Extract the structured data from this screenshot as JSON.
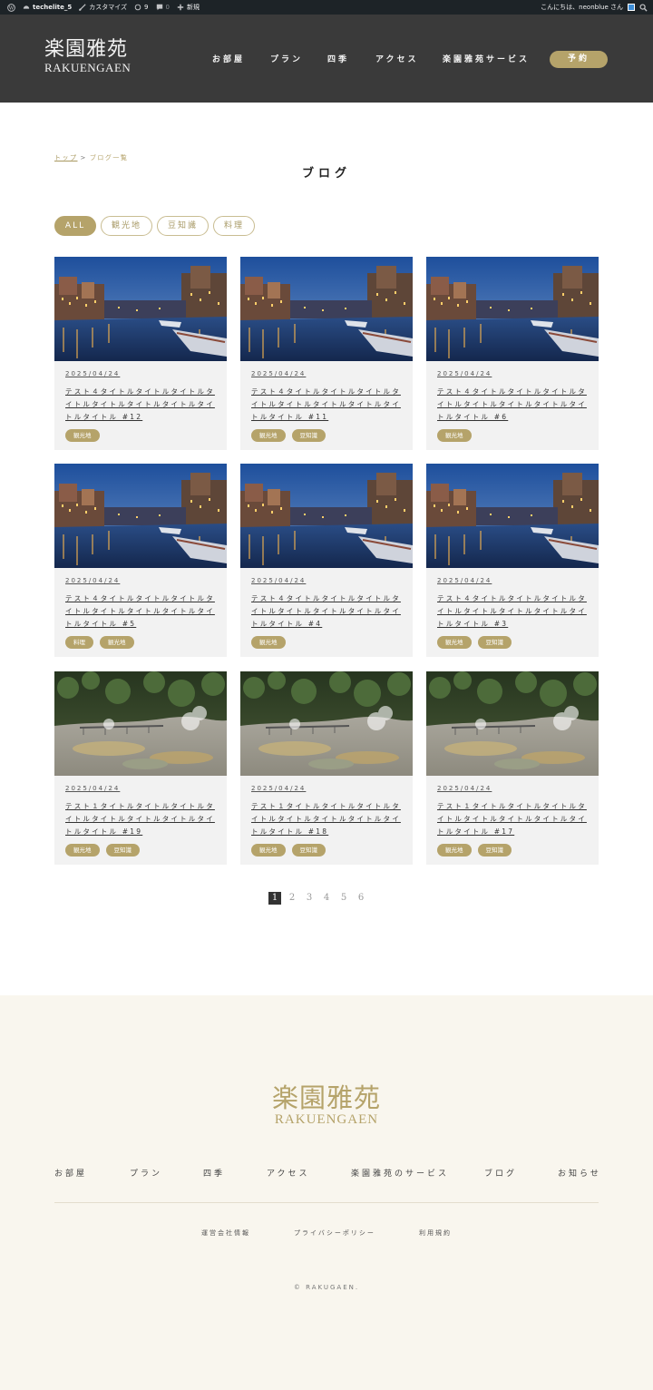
{
  "admin_bar": {
    "site_name": "techelite_5",
    "customize": "カスタマイズ",
    "updates_count": "9",
    "comments_count": "0",
    "new_label": "新規",
    "greeting": "こんにちは、neonblue さん"
  },
  "header": {
    "logo_jp": "楽園雅苑",
    "logo_en": "RAKUENGAEN",
    "nav": [
      "お部屋",
      "プラン",
      "四季",
      "アクセス",
      "楽園雅苑サービス"
    ],
    "reserve_label": "予約"
  },
  "breadcrumb": {
    "top": "トップ",
    "separator": ">",
    "current": "ブログ一覧"
  },
  "page_title": "ブログ",
  "filters": [
    "ALL",
    "観光地",
    "豆知識",
    "料理"
  ],
  "posts": [
    {
      "date": "2025/04/24",
      "title": "テスト４タイトルタイトルタイトルタイトルタイトルタイトルタイトルタイトルタイトル #12",
      "tags": [
        "観光地"
      ],
      "image": "canal-night"
    },
    {
      "date": "2025/04/24",
      "title": "テスト４タイトルタイトルタイトルタイトルタイトルタイトルタイトルタイトルタイトル #11",
      "tags": [
        "観光地",
        "豆知識"
      ],
      "image": "canal-night"
    },
    {
      "date": "2025/04/24",
      "title": "テスト４タイトルタイトルタイトルタイトルタイトルタイトルタイトルタイトルタイトル #6",
      "tags": [
        "観光地"
      ],
      "image": "canal-night"
    },
    {
      "date": "2025/04/24",
      "title": "テスト４タイトルタイトルタイトルタイトルタイトルタイトルタイトルタイトルタイトル #5",
      "tags": [
        "料理",
        "観光地"
      ],
      "image": "canal-night"
    },
    {
      "date": "2025/04/24",
      "title": "テスト４タイトルタイトルタイトルタイトルタイトルタイトルタイトルタイトルタイトル #4",
      "tags": [
        "観光地"
      ],
      "image": "canal-night"
    },
    {
      "date": "2025/04/24",
      "title": "テスト４タイトルタイトルタイトルタイトルタイトルタイトルタイトルタイトルタイトル #3",
      "tags": [
        "観光地",
        "豆知識"
      ],
      "image": "canal-night"
    },
    {
      "date": "2025/04/24",
      "title": "テスト１タイトルタイトルタイトルタイトルタイトルタイトルタイトルタイトルタイトル #19",
      "tags": [
        "観光地",
        "豆知識"
      ],
      "image": "hot-spring"
    },
    {
      "date": "2025/04/24",
      "title": "テスト１タイトルタイトルタイトルタイトルタイトルタイトルタイトルタイトルタイトル #18",
      "tags": [
        "観光地",
        "豆知識"
      ],
      "image": "hot-spring"
    },
    {
      "date": "2025/04/24",
      "title": "テスト１タイトルタイトルタイトルタイトルタイトルタイトルタイトルタイトルタイトル #17",
      "tags": [
        "観光地",
        "豆知識"
      ],
      "image": "hot-spring"
    }
  ],
  "pagination": {
    "pages": [
      "1",
      "2",
      "3",
      "4",
      "5",
      "6"
    ],
    "current": "1"
  },
  "footer": {
    "logo_jp": "楽園雅苑",
    "logo_en": "RAKUENGAEN",
    "nav": [
      "お部屋",
      "プラン",
      "四季",
      "アクセス",
      "楽園雅苑のサービス",
      "ブログ",
      "お知らせ"
    ],
    "sub_links": [
      "運営会社情報",
      "プライバシーポリシー",
      "利用規約"
    ],
    "copyright": "© RAKUGAEN."
  },
  "colors": {
    "accent": "#b5a36a",
    "header_bg": "#3a3a3a",
    "footer_bg": "#f9f6ee",
    "card_bg": "#f2f2f2"
  }
}
